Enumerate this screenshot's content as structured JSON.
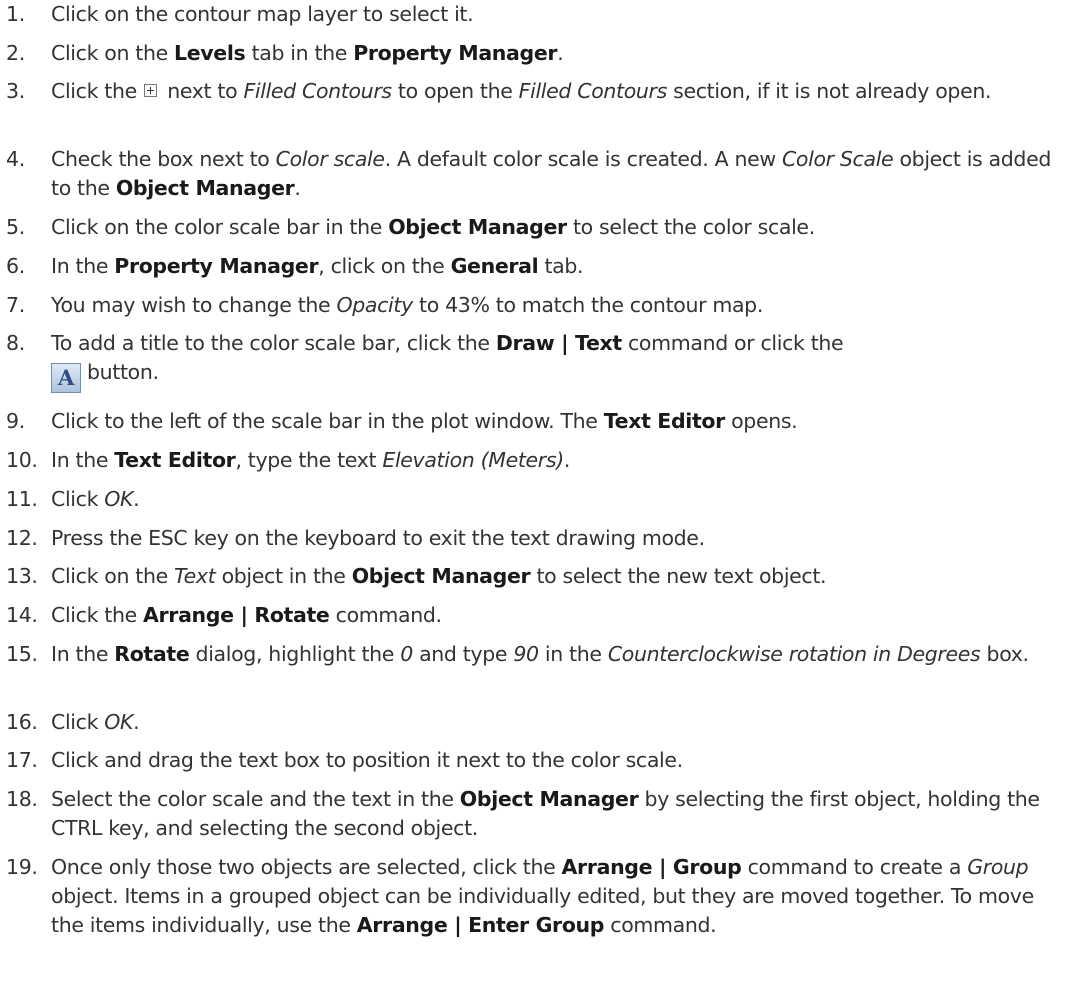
{
  "steps": [
    {
      "num": "1.",
      "segments": [
        {
          "t": "Click on the contour map layer to select it."
        }
      ]
    },
    {
      "num": "2.",
      "segments": [
        {
          "t": "Click on the "
        },
        {
          "t": "Levels",
          "b": true
        },
        {
          "t": " tab in the "
        },
        {
          "t": "Property Manager",
          "b": true
        },
        {
          "t": "."
        }
      ]
    },
    {
      "num": "3.",
      "segments": [
        {
          "t": "Click the "
        },
        {
          "icon": "plus-box"
        },
        {
          "t": " next to "
        },
        {
          "t": "Filled Contours",
          "i": true
        },
        {
          "t": " to open the "
        },
        {
          "t": "Filled Contours",
          "i": true
        },
        {
          "t": " section, if it is not already open."
        }
      ]
    },
    {
      "num": "4.",
      "segments": [
        {
          "t": "Check the box next to "
        },
        {
          "t": "Color scale",
          "i": true
        },
        {
          "t": ". A default color scale is created. A new "
        },
        {
          "t": "Color Scale",
          "i": true
        },
        {
          "t": " object is added to the "
        },
        {
          "t": "Object Manager",
          "b": true
        },
        {
          "t": "."
        }
      ]
    },
    {
      "num": "5.",
      "segments": [
        {
          "t": "Click on the color scale bar in the "
        },
        {
          "t": "Object Manager",
          "b": true
        },
        {
          "t": " to select the color scale."
        }
      ]
    },
    {
      "num": "6.",
      "segments": [
        {
          "t": "In the "
        },
        {
          "t": "Property Manager",
          "b": true
        },
        {
          "t": ", click on the "
        },
        {
          "t": "General",
          "b": true
        },
        {
          "t": " tab."
        }
      ]
    },
    {
      "num": "7.",
      "segments": [
        {
          "t": "You may wish to change the "
        },
        {
          "t": "Opacity",
          "i": true
        },
        {
          "t": " to 43% to match the contour map."
        }
      ]
    },
    {
      "num": "8.",
      "segments": [
        {
          "t": "To add a title to the color scale bar, click the "
        },
        {
          "t": "Draw | Text",
          "b": true
        },
        {
          "t": " command or click the "
        },
        {
          "break": true
        },
        {
          "icon": "text-tool",
          "label": "A"
        },
        {
          "t": "button."
        }
      ]
    },
    {
      "num": "9.",
      "segments": [
        {
          "t": "Click to the left of the scale bar in the plot window. The "
        },
        {
          "t": "Text Editor",
          "b": true
        },
        {
          "t": " opens."
        }
      ]
    },
    {
      "num": "10.",
      "segments": [
        {
          "t": "In the "
        },
        {
          "t": "Text Editor",
          "b": true
        },
        {
          "t": ", type the text "
        },
        {
          "t": "Elevation (Meters)",
          "i": true
        },
        {
          "t": "."
        }
      ]
    },
    {
      "num": "11.",
      "segments": [
        {
          "t": "Click "
        },
        {
          "t": "OK",
          "i": true
        },
        {
          "t": "."
        }
      ]
    },
    {
      "num": "12.",
      "segments": [
        {
          "t": "Press the ESC key on the keyboard to exit the text drawing mode."
        }
      ]
    },
    {
      "num": "13.",
      "segments": [
        {
          "t": "Click on the "
        },
        {
          "t": "Text",
          "i": true
        },
        {
          "t": " object in the "
        },
        {
          "t": "Object Manager",
          "b": true
        },
        {
          "t": " to select the new text object."
        }
      ]
    },
    {
      "num": "14.",
      "segments": [
        {
          "t": "Click the "
        },
        {
          "t": "Arrange | Rotate",
          "b": true
        },
        {
          "t": " command."
        }
      ]
    },
    {
      "num": "15.",
      "segments": [
        {
          "t": "In the "
        },
        {
          "t": "Rotate",
          "b": true
        },
        {
          "t": " dialog, highlight the "
        },
        {
          "t": "0",
          "i": true
        },
        {
          "t": " and type "
        },
        {
          "t": "90",
          "i": true
        },
        {
          "t": " in the "
        },
        {
          "t": "Counterclockwise rotation in Degrees",
          "i": true
        },
        {
          "t": " box."
        }
      ]
    },
    {
      "num": "16.",
      "segments": [
        {
          "t": "Click "
        },
        {
          "t": "OK",
          "i": true
        },
        {
          "t": "."
        }
      ]
    },
    {
      "num": "17.",
      "segments": [
        {
          "t": "Click and drag the text box to position it next to the color scale."
        }
      ]
    },
    {
      "num": "18.",
      "segments": [
        {
          "t": "Select the color scale and the text in the "
        },
        {
          "t": "Object Manager",
          "b": true
        },
        {
          "t": " by selecting the first object, holding the CTRL key, and selecting the second object."
        }
      ]
    },
    {
      "num": "19.",
      "segments": [
        {
          "t": "Once only those two objects are selected, click the "
        },
        {
          "t": "Arrange | Group",
          "b": true
        },
        {
          "t": " command to create a "
        },
        {
          "t": "Group",
          "i": true
        },
        {
          "t": " object. Items in a grouped object can be individually edited, but they are moved together. To move the items individually, use the "
        },
        {
          "t": "Arrange | Enter Group",
          "b": true
        },
        {
          "t": " command."
        }
      ]
    }
  ]
}
